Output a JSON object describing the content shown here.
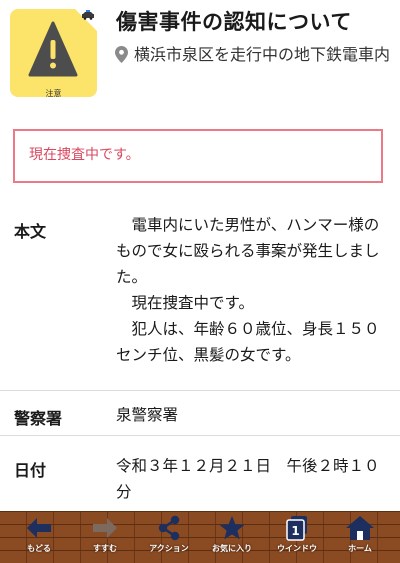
{
  "alert": {
    "icon_label": "注意",
    "title": "傷害事件の認知について",
    "location": "横浜市泉区を走行中の地下鉄電車内"
  },
  "status": "現在捜査中です。",
  "details": {
    "body_label": "本文",
    "body_paragraphs": [
      "電車内にいた男性が、ハンマー様のもので女に殴られる事案が発生しました。",
      "現在捜査中です。",
      "犯人は、年齢６０歳位、身長１５０センチ位、黒髪の女です。"
    ],
    "station_label": "警察署",
    "station_value": "泉警察署",
    "date_label": "日付",
    "date_value": "令和３年１２月２１日　午後２時１０分"
  },
  "toolbar": {
    "back": "もどる",
    "forward": "すすむ",
    "action": "アクション",
    "favorites": "お気に入り",
    "window": "ウインドウ",
    "window_count": "1",
    "home": "ホーム"
  },
  "colors": {
    "alert_bg": "#fce36a",
    "status_border": "#e97a86",
    "status_text": "#d9485f",
    "toolbar_bg": "#8a4a22",
    "toolbar_icon": "#1c2f5e"
  }
}
